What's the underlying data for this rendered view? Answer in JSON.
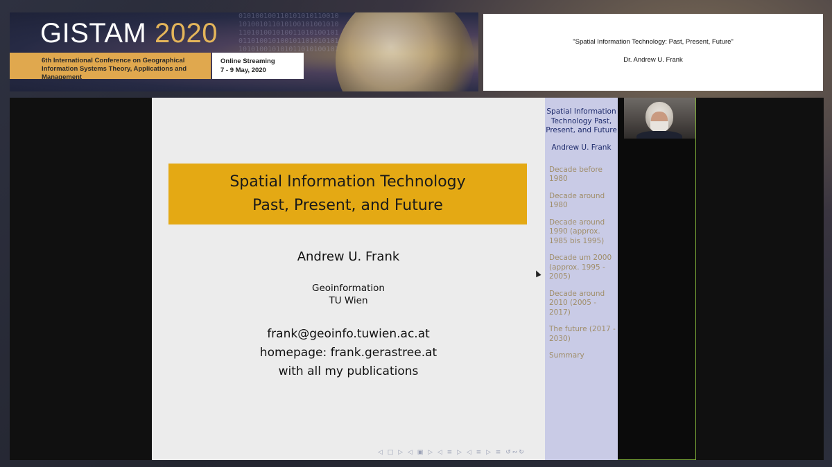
{
  "banner": {
    "title_main": "GISTAM",
    "title_year": "2020",
    "subtitle_line1": "6th International Conference on Geographical",
    "subtitle_line2": "Information Systems Theory, Applications and Management",
    "streaming_label": "Online Streaming",
    "dates": "7 - 9 May, 2020"
  },
  "talk": {
    "title": "\"Spatial Information Technology: Past, Present, Future\"",
    "speaker": "Dr. Andrew U. Frank"
  },
  "slide": {
    "title_line1": "Spatial Information Technology",
    "title_line2": "Past, Present, and Future",
    "author": "Andrew U. Frank",
    "institution_line1": "Geoinformation",
    "institution_line2": "TU Wien",
    "email": "frank@geoinfo.tuwien.ac.at",
    "homepage": "homepage:  frank.gerastree.at",
    "publications": "with all my publications",
    "nav_symbols": "◁ □ ▷ ◁ ▣ ▷ ◁ ≡ ▷ ◁ ≡ ▷ ≡ ↺∾↻"
  },
  "sidebar": {
    "title": "Spatial Information Technology Past, Present, and Future",
    "author": "Andrew U. Frank",
    "sections": [
      "Decade before 1980",
      "Decade around 1980",
      "Decade around 1990 (approx. 1985 bis 1995)",
      "Decade um 2000 (approx. 1995 - 2005)",
      "Decade around 2010 (2005 - 2017)",
      "The future (2017 - 2030)",
      "Summary"
    ]
  },
  "colors": {
    "accent_gold": "#e4a914",
    "sidebar_bg": "#c9cbe6",
    "sidebar_link": "#a08e6a",
    "frame_green": "#7fae39"
  }
}
